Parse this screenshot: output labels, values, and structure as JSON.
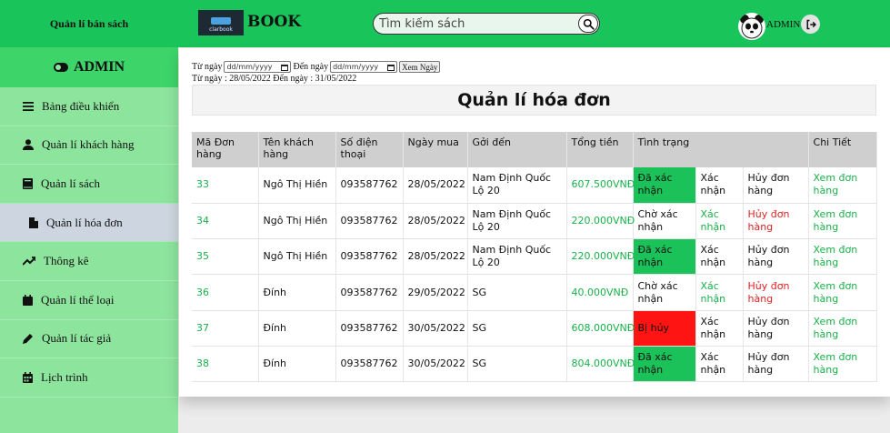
{
  "header": {
    "brand": "Quản lí bán sách",
    "logo_small": "clarbook",
    "logo_text": "BOOK",
    "search_placeholder": "Tìm kiếm sách",
    "admin_name": "ADMIN"
  },
  "sidebar": {
    "title": "ADMIN",
    "items": [
      {
        "label": "Bảng điều khiển",
        "icon": "menu-icon"
      },
      {
        "label": "Quản lí khách hàng",
        "icon": "user-icon"
      },
      {
        "label": "Quản lí sách",
        "icon": "book-icon"
      },
      {
        "label": "Quản lí hóa đơn",
        "icon": "file-icon"
      },
      {
        "label": "Thông kê",
        "icon": "trend-icon"
      },
      {
        "label": "Quản lí thể loại",
        "icon": "calendar-icon"
      },
      {
        "label": "Quản lí tác giả",
        "icon": "pencil-icon"
      },
      {
        "label": "Lịch trình",
        "icon": "calendar-grid-icon"
      }
    ]
  },
  "filter": {
    "from_label": "Từ ngày",
    "to_label": "Đến ngày",
    "date_placeholder": "dd/mm/yyyy",
    "see_button": "Xem Ngày",
    "range_text": "Từ ngày : 28/05/2022 Đến ngày : 31/05/2022"
  },
  "page_title": "Quản lí hóa đơn",
  "table": {
    "headers": [
      "Mã Đơn hàng",
      "Tên khách hàng",
      "Số điện thoại",
      "Ngày mua",
      "Gởi đến",
      "Tổng tiền",
      "Tình trạng",
      "Chi Tiết"
    ],
    "rows": [
      {
        "id": "33",
        "name": "Ngô Thị Hiền",
        "phone": "093587762",
        "date": "28/05/2022",
        "address": "Nam Định Quốc Lộ 20",
        "total": "607.500VNĐ",
        "status": "Đã xác nhận",
        "status_type": "ok",
        "confirm": "Xác nhận",
        "confirm_color": "dark",
        "cancel": "Hủy đơn hàng",
        "cancel_color": "dark",
        "detail": "Xem đơn hàng"
      },
      {
        "id": "34",
        "name": "Ngô Thị Hiền",
        "phone": "093587762",
        "date": "28/05/2022",
        "address": "Nam Định Quốc Lộ 20",
        "total": "220.000VNĐ",
        "status": "Chờ xác nhận",
        "status_type": "plain",
        "confirm": "Xác nhận",
        "confirm_color": "green",
        "cancel": "Hủy đơn hàng",
        "cancel_color": "red",
        "detail": "Xem đơn hàng"
      },
      {
        "id": "35",
        "name": "Ngô Thị Hiền",
        "phone": "093587762",
        "date": "28/05/2022",
        "address": "Nam Định Quốc Lộ 20",
        "total": "220.000VNĐ",
        "status": "Đã xác nhận",
        "status_type": "ok",
        "confirm": "Xác nhận",
        "confirm_color": "dark",
        "cancel": "Hủy đơn hàng",
        "cancel_color": "dark",
        "detail": "Xem đơn hàng"
      },
      {
        "id": "36",
        "name": "Đính",
        "phone": "093587762",
        "date": "29/05/2022",
        "address": "SG",
        "total": "40.000VNĐ",
        "status": "Chờ xác nhận",
        "status_type": "plain",
        "confirm": "Xác nhận",
        "confirm_color": "green",
        "cancel": "Hủy đơn hàng",
        "cancel_color": "red",
        "detail": "Xem đơn hàng"
      },
      {
        "id": "37",
        "name": "Đính",
        "phone": "093587762",
        "date": "30/05/2022",
        "address": "SG",
        "total": "608.000VNĐ",
        "status": "Bị hủy",
        "status_type": "cancel",
        "confirm": "Xác nhận",
        "confirm_color": "dark",
        "cancel": "Hủy đơn hàng",
        "cancel_color": "dark",
        "detail": "Xem đơn hàng"
      },
      {
        "id": "38",
        "name": "Đính",
        "phone": "093587762",
        "date": "30/05/2022",
        "address": "SG",
        "total": "804.000VNĐ",
        "status": "Đã xác nhận",
        "status_type": "ok",
        "confirm": "Xác nhận",
        "confirm_color": "dark",
        "cancel": "Hủy đơn hàng",
        "cancel_color": "dark",
        "detail": "Xem đơn hàng"
      }
    ]
  },
  "colors": {
    "header_bg": "#19c45a",
    "sidebar_bg": "#8de49d",
    "status_ok": "#1bc25a",
    "status_cancel": "#ff1414",
    "link_green": "#19b14a",
    "link_red": "#e02020"
  }
}
